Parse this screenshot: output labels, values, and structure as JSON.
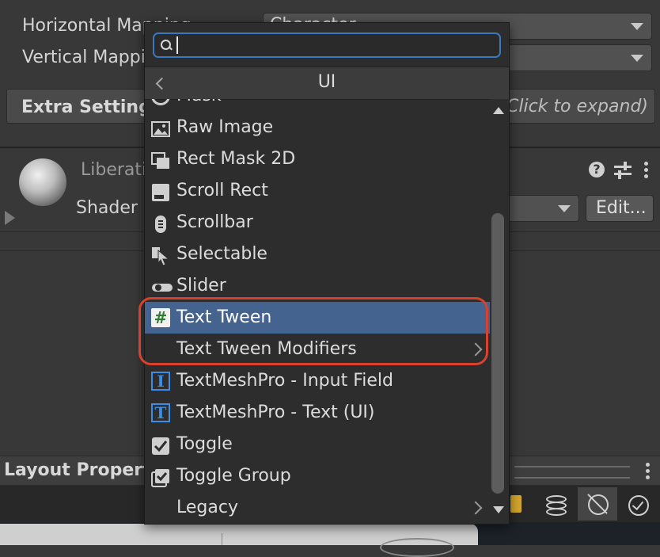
{
  "inspector": {
    "horizontal_mapping_label": "Horizontal Mapping",
    "horizontal_mapping_value": "Character",
    "vertical_mapping_label": "Vertical Mapping",
    "extra_settings_label": "Extra Settings",
    "extra_settings_hint": "(Click to expand)",
    "material_name": "LiberationSans SDF Material",
    "shader_label": "Shader",
    "edit_button": "Edit...",
    "layout_properties_label": "Layout Properties"
  },
  "popup": {
    "search_placeholder": "",
    "title": "UI",
    "partial_top_item": "Mask",
    "items": [
      {
        "label": "Raw Image",
        "icon": "raw-image-icon"
      },
      {
        "label": "Rect Mask 2D",
        "icon": "rect-mask-icon"
      },
      {
        "label": "Scroll Rect",
        "icon": "scroll-rect-icon"
      },
      {
        "label": "Scrollbar",
        "icon": "scrollbar-icon"
      },
      {
        "label": "Selectable",
        "icon": "selectable-icon"
      },
      {
        "label": "Slider",
        "icon": "slider-icon"
      },
      {
        "label": "Text Tween",
        "icon": "script-hash-icon",
        "selected": true
      },
      {
        "label": "Text Tween Modifiers",
        "submenu": true
      },
      {
        "label": "TextMeshPro - Input Field",
        "icon": "tmp-input-icon"
      },
      {
        "label": "TextMeshPro - Text (UI)",
        "icon": "tmp-text-icon"
      },
      {
        "label": "Toggle",
        "icon": "toggle-icon"
      },
      {
        "label": "Toggle Group",
        "icon": "toggle-group-icon"
      },
      {
        "label": "Legacy",
        "submenu": true
      }
    ]
  },
  "colors": {
    "selection": "#44638f",
    "highlight_outline": "#d9402e",
    "search_focus": "#3a79bd"
  }
}
